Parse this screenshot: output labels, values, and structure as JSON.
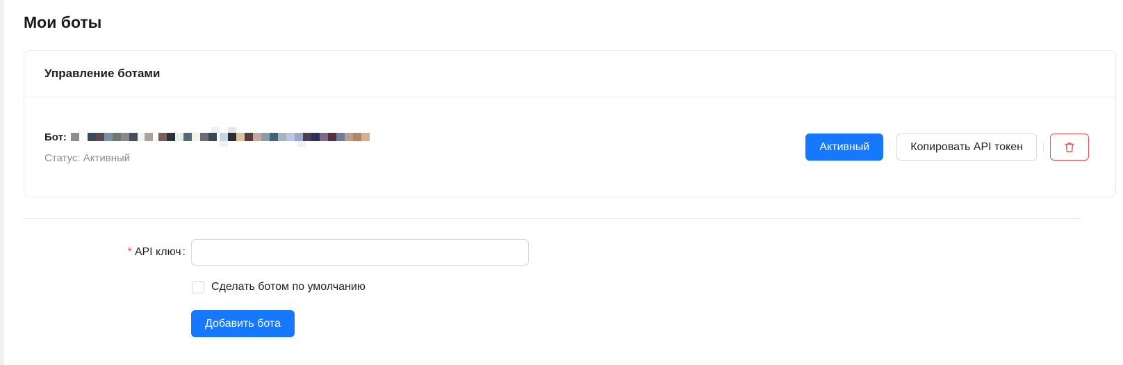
{
  "page": {
    "title": "Мои боты"
  },
  "bots_card": {
    "title": "Управление ботами",
    "bot": {
      "label": "Бот:",
      "status": "Статус: Активный"
    },
    "actions": {
      "active_label": "Активный",
      "copy_token_label": "Копировать API токен",
      "delete_icon": "trash-icon"
    }
  },
  "form": {
    "api_key_label": "API ключ",
    "api_key_value": "",
    "default_checkbox_label": "Сделать ботом по умолчанию",
    "default_checked": false,
    "add_button_label": "Добавить бота"
  },
  "colors": {
    "primary": "#1677ff",
    "danger": "#ff4d4f",
    "border": "#d9d9d9",
    "muted_text": "#8c8c8c"
  }
}
